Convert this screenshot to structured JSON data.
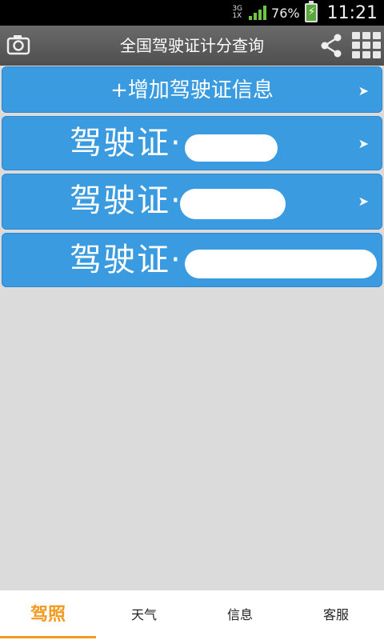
{
  "status_bar": {
    "network_top": "3G",
    "network_bottom": "1X",
    "battery_percent": "76%",
    "time": "11:21",
    "signal_color": "#6cc644"
  },
  "header": {
    "title": "全国驾驶证计分查询",
    "left_icon": "camera-icon",
    "right_icons": [
      "share-icon",
      "grid-menu-icon"
    ]
  },
  "list": {
    "add_label": "+增加驾驶证信息",
    "items": [
      {
        "label": "驾驶证·"
      },
      {
        "label": "驾驶证·"
      },
      {
        "label": "驾驶证·"
      }
    ],
    "row_color": "#3b9be0"
  },
  "tabs": [
    {
      "label": "驾照",
      "active": true
    },
    {
      "label": "天气",
      "active": false
    },
    {
      "label": "信息",
      "active": false
    },
    {
      "label": "客服",
      "active": false
    }
  ],
  "accent_color": "#f39a1e"
}
